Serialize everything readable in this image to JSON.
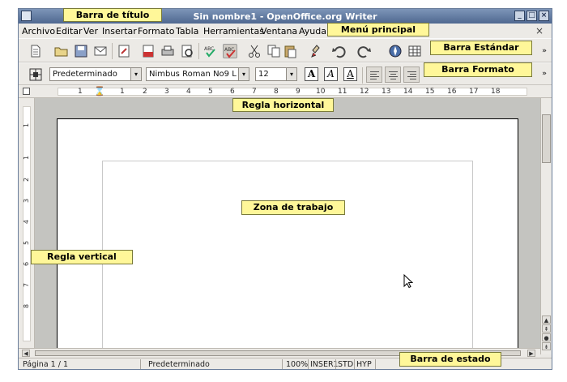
{
  "window": {
    "title": "Sin nombre1 - OpenOffice.org Writer",
    "minimize": "_",
    "maximize": "□",
    "close": "×"
  },
  "menu": {
    "items": [
      "Archivo",
      "Editar",
      "Ver",
      "Insertar",
      "Formato",
      "Tabla",
      "Herramientas",
      "Ventana",
      "Ayuda"
    ],
    "close_doc": "×"
  },
  "format_bar": {
    "style": "Predeterminado",
    "font": "Nimbus Roman No9 L",
    "size": "12",
    "bold": "A",
    "italic": "A",
    "underline": "A"
  },
  "ruler": {
    "h_ticks": [
      "1",
      "1",
      "2",
      "3",
      "4",
      "5",
      "6",
      "7",
      "8",
      "9",
      "10",
      "11",
      "12",
      "13",
      "14",
      "15",
      "16",
      "17",
      "18"
    ],
    "v_ticks": [
      "1",
      "1",
      "2",
      "3",
      "4",
      "5",
      "6",
      "7",
      "8"
    ]
  },
  "status": {
    "page": "Página  1 / 1",
    "style": "Predeterminado",
    "zoom": "100%",
    "insert": "INSER1",
    "std": "STD",
    "hyp": "HYP"
  },
  "callouts": {
    "title_bar": "Barra de título",
    "main_menu": "Menú principal",
    "standard_bar": "Barra Estándar",
    "format_bar": "Barra Formato",
    "h_ruler": "Regla horizontal",
    "work_area": "Zona de trabajo",
    "v_ruler": "Regla vertical",
    "status_bar": "Barra de estado"
  },
  "colors": {
    "callout_bg": "#fff799",
    "titlebar": "#5b7398"
  }
}
